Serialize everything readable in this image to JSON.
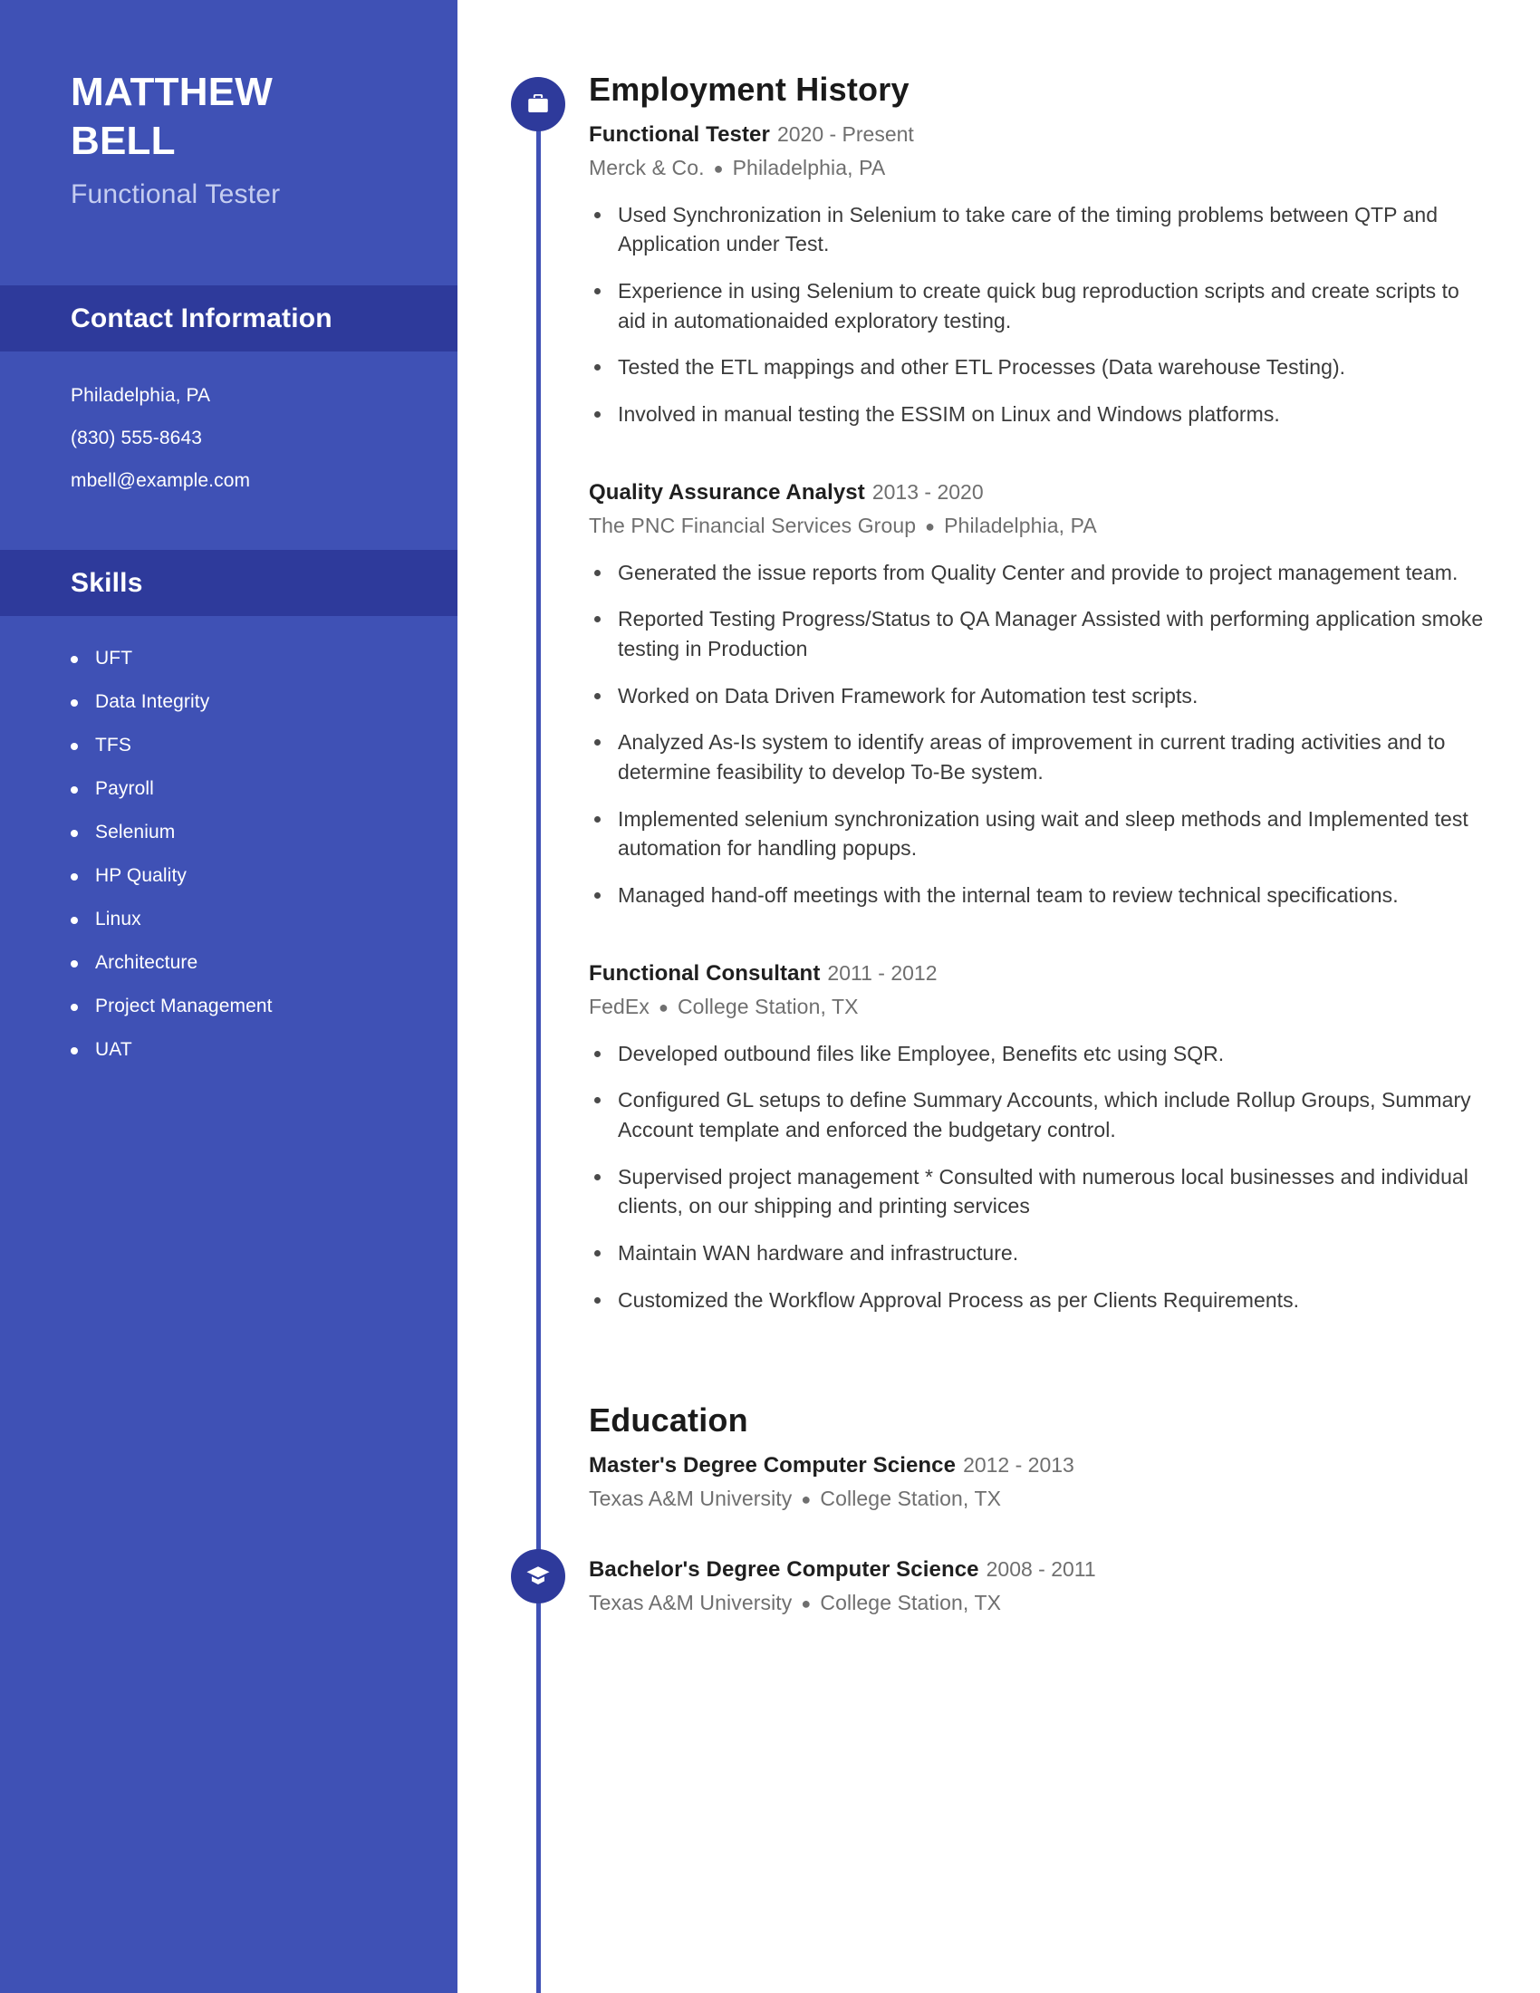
{
  "colors": {
    "sidebar_bg": "#3f51b5",
    "sidebar_band": "#2e3a9b",
    "accent": "#2e3a9b",
    "timeline": "#3f51b5",
    "subtitle": "#c5cdf0",
    "body_text": "#3a3a3a",
    "muted_text": "#6f6f6f"
  },
  "sidebar": {
    "name_line1": "MATTHEW",
    "name_line2": "BELL",
    "job_title": "Functional Tester",
    "contact": {
      "heading": "Contact Information",
      "items": [
        "Philadelphia, PA",
        "(830) 555-8643",
        "mbell@example.com"
      ]
    },
    "skills": {
      "heading": "Skills",
      "items": [
        "UFT",
        "Data Integrity",
        "TFS",
        "Payroll",
        "Selenium",
        "HP Quality",
        "Linux",
        "Architecture",
        "Project Management",
        "UAT"
      ]
    }
  },
  "main": {
    "employment": {
      "heading": "Employment History",
      "icon": "briefcase-icon",
      "jobs": [
        {
          "role": "Functional Tester",
          "dates": "2020 - Present",
          "company": "Merck & Co.",
          "location": "Philadelphia, PA",
          "bullets": [
            "Used Synchronization in Selenium to take care of the timing problems between QTP and Application under Test.",
            "Experience in using Selenium to create quick bug reproduction scripts and create scripts to aid in automationaided exploratory testing.",
            "Tested the ETL mappings and other ETL Processes (Data warehouse Testing).",
            "Involved in manual testing the ESSIM on Linux and Windows platforms."
          ]
        },
        {
          "role": "Quality Assurance Analyst",
          "dates": "2013 - 2020",
          "company": "The PNC Financial Services Group",
          "location": "Philadelphia, PA",
          "bullets": [
            "Generated the issue reports from Quality Center and provide to project management team.",
            "Reported Testing Progress/Status to QA Manager Assisted with performing application smoke testing in Production",
            "Worked on Data Driven Framework for Automation test scripts.",
            "Analyzed As-Is system to identify areas of improvement in current trading activities and to determine feasibility to develop To-Be system.",
            "Implemented selenium synchronization using wait and sleep methods and Implemented test automation for handling popups.",
            "Managed hand-off meetings with the internal team to review technical specifications."
          ]
        },
        {
          "role": "Functional Consultant",
          "dates": "2011 - 2012",
          "company": "FedEx",
          "location": "College Station, TX",
          "bullets": [
            "Developed outbound files like Employee, Benefits etc using SQR.",
            "Configured GL setups to define Summary Accounts, which include Rollup Groups, Summary Account template and enforced the budgetary control.",
            "Supervised project management * Consulted with numerous local businesses and individual clients, on our shipping and printing services",
            "Maintain WAN hardware and infrastructure.",
            "Customized the Workflow Approval Process as per Clients Requirements."
          ]
        }
      ]
    },
    "education": {
      "heading": "Education",
      "icon": "graduation-cap-icon",
      "entries": [
        {
          "degree": "Master's Degree Computer Science",
          "dates": "2012 - 2013",
          "school": "Texas A&M University",
          "location": "College Station, TX"
        },
        {
          "degree": "Bachelor's Degree Computer Science",
          "dates": "2008 - 2011",
          "school": "Texas A&M University",
          "location": "College Station, TX"
        }
      ]
    }
  }
}
